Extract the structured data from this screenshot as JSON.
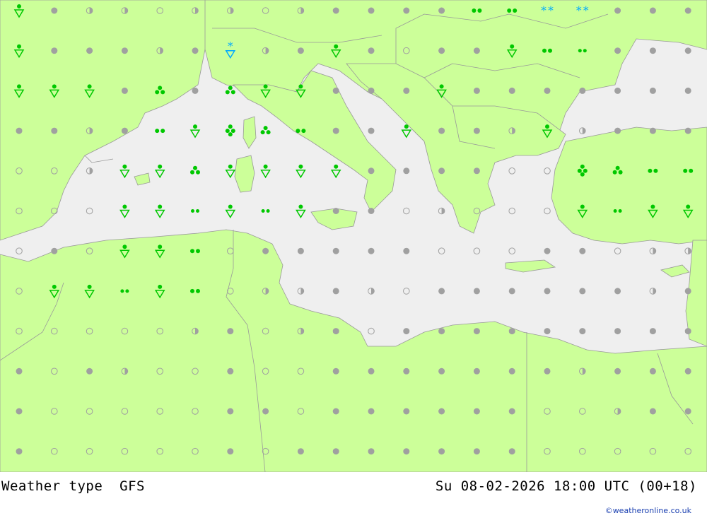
{
  "footer": {
    "product": "Weather type",
    "model": "GFS",
    "valid_time": "Su 08-02-2026 18:00 UTC (00+18)",
    "credit": "©weatheronline.co.uk"
  },
  "colors": {
    "land": "#ccff99",
    "sea": "#efefef",
    "border": "#999999",
    "cloud_symbol": "#a0a0a0",
    "rain_symbol": "#00c800",
    "snow_symbol": "#00aaff"
  },
  "grid": {
    "columns": 20,
    "rows": 12,
    "symbol_legend_icons": [
      "overcast-dot",
      "cloudy-dot",
      "partly-cloudy-dot",
      "clear-circle",
      "rain-shower-icon",
      "rain-icon",
      "heavy-rain-icon",
      "snow-shower-icon",
      "snow-icon"
    ],
    "symbols": [
      [
        "SHR",
        "OVC",
        "PC",
        "PC",
        "CLR",
        "PC",
        "PC",
        "CLR",
        "PC",
        "OVC",
        "OVC",
        "OVC",
        "OVC",
        "RN2",
        "RN2",
        "SN2",
        "SN2",
        "OVC",
        "OVC",
        "OVC"
      ],
      [
        "SHR",
        "OVC",
        "OVC",
        "OVC",
        "PC",
        "OVC",
        "SNS",
        "PC",
        "OVC",
        "SHR",
        "OVC",
        "CLR",
        "OVC",
        "OVC",
        "SHR",
        "RN2",
        "RN2S",
        "OVC",
        "OVC",
        "OVC"
      ],
      [
        "SHR",
        "SHR",
        "SHR",
        "OVC",
        "RN3",
        "OVC",
        "RN3",
        "SHR",
        "SHR",
        "OVC",
        "OVC",
        "OVC",
        "SHR",
        "OVC",
        "OVC",
        "OVC",
        "OVC",
        "OVC",
        "OVC",
        "OVC"
      ],
      [
        "OVC",
        "OVC",
        "PC",
        "OVC",
        "RN2",
        "SHR",
        "RN4",
        "RN3",
        "RN2",
        "OVC",
        "OVC",
        "SHR",
        "OVC",
        "OVC",
        "PC",
        "SHR",
        "PC",
        "OVC",
        "OVC",
        "OVC"
      ],
      [
        "CLR",
        "CLR",
        "PC",
        "SHR",
        "SHR",
        "RN3",
        "SHR",
        "SHR",
        "SHR",
        "SHR",
        "OVC",
        "OVC",
        "OVC",
        "OVC",
        "CLR",
        "CLR",
        "RN4",
        "RN3",
        "RN2",
        "RN2"
      ],
      [
        "CLR",
        "CLR",
        "CLR",
        "SHR",
        "SHR",
        "RN2S",
        "SHR",
        "RN2S",
        "SHR",
        "OVC",
        "OVC",
        "CLR",
        "PC",
        "CLR",
        "CLR",
        "CLR",
        "SHR",
        "RN2S",
        "SHR",
        "SHR"
      ],
      [
        "CLR",
        "OVC",
        "CLR",
        "SHR",
        "SHR",
        "RN2",
        "CLR",
        "OVC",
        "OVC",
        "OVC",
        "OVC",
        "OVC",
        "CLR",
        "CLR",
        "CLR",
        "OVC",
        "OVC",
        "CLR",
        "PC",
        "PC"
      ],
      [
        "CLR",
        "SHR",
        "SHR",
        "RN2S",
        "SHR",
        "RN2",
        "CLR",
        "PC",
        "PC",
        "OVC",
        "PC",
        "CLR",
        "OVC",
        "OVC",
        "OVC",
        "OVC",
        "OVC",
        "OVC",
        "PC",
        "OVC"
      ],
      [
        "CLR",
        "CLR",
        "CLR",
        "CLR",
        "CLR",
        "PC",
        "OVC",
        "CLR",
        "PC",
        "OVC",
        "CLR",
        "OVC",
        "OVC",
        "OVC",
        "OVC",
        "OVC",
        "OVC",
        "OVC",
        "OVC",
        "OVC"
      ],
      [
        "OVC",
        "CLR",
        "OVC",
        "PC",
        "CLR",
        "CLR",
        "OVC",
        "CLR",
        "CLR",
        "OVC",
        "OVC",
        "OVC",
        "OVC",
        "OVC",
        "OVC",
        "OVC",
        "PC",
        "OVC",
        "OVC",
        "OVC"
      ],
      [
        "OVC",
        "CLR",
        "CLR",
        "CLR",
        "CLR",
        "CLR",
        "OVC",
        "OVC",
        "CLR",
        "OVC",
        "OVC",
        "OVC",
        "OVC",
        "OVC",
        "OVC",
        "CLR",
        "CLR",
        "PC",
        "OVC",
        "OVC"
      ],
      [
        "OVC",
        "CLR",
        "CLR",
        "CLR",
        "CLR",
        "CLR",
        "OVC",
        "CLR",
        "OVC",
        "OVC",
        "OVC",
        "OVC",
        "OVC",
        "OVC",
        "OVC",
        "CLR",
        "CLR",
        "CLR",
        "CLR",
        "CLR"
      ]
    ]
  }
}
